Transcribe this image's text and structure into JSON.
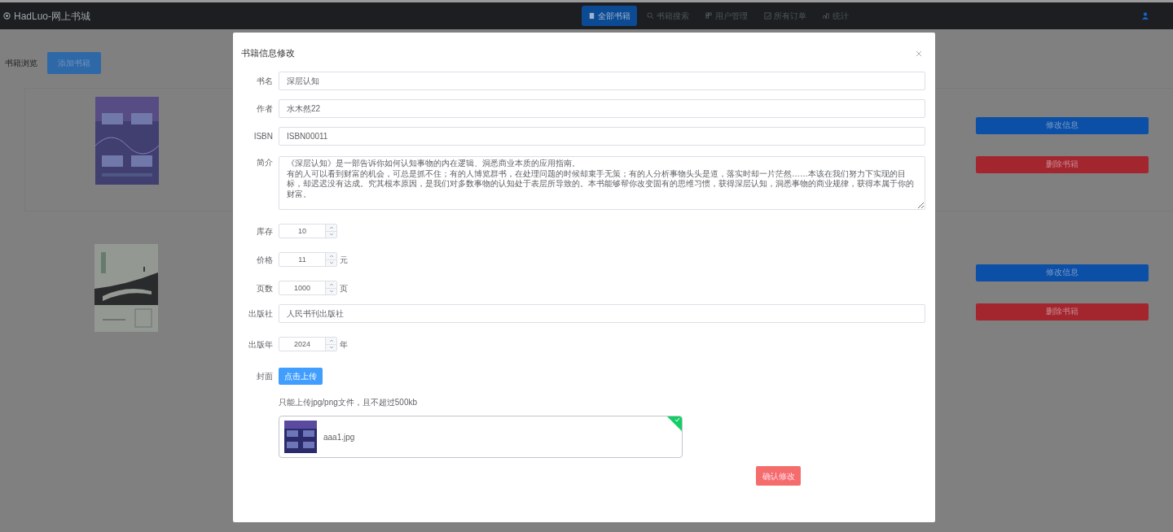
{
  "navbar": {
    "brand": "HadLuo-网上书城",
    "items": [
      {
        "label": "全部书籍",
        "selected": true
      },
      {
        "label": "书籍搜索",
        "selected": false
      },
      {
        "label": "用户管理",
        "selected": false
      },
      {
        "label": "所有订单",
        "selected": false
      },
      {
        "label": "统计",
        "selected": false
      }
    ]
  },
  "page": {
    "heading": "书籍浏览",
    "add_button": "添加书籍",
    "books": [
      {
        "buttons": [
          "修改信息",
          "删除书籍"
        ]
      },
      {
        "buttons": [
          "修改信息",
          "删除书籍"
        ]
      }
    ]
  },
  "modal": {
    "title": "书籍信息修改",
    "fields": [
      {
        "kind": "text",
        "label": "书名",
        "value": "深层认知"
      },
      {
        "kind": "text",
        "label": "作者",
        "value": "水木然22"
      },
      {
        "kind": "text",
        "label": "ISBN",
        "value": "ISBN00011"
      },
      {
        "kind": "textarea",
        "label": "简介",
        "lines": [
          "《深层认知》是一部告诉你如何认知事物的内在逻辑、洞悉商业本质的应用指南。",
          "有的人可以看到财富的机会，可总是抓不住；有的人博览群书，在处理问题的时候却束手无策；有的人分析事物头头是道，落实时却一片茫然……本该在我们努力下实现的目标，却迟迟没有达成。究其根本原因，是我们对多数事物的认知处于表层所导致的。本书能够帮你改变固有的思维习惯，获得深层认知，洞悉事物的商业规律，获得本属于你的财富。"
        ]
      },
      {
        "kind": "number",
        "label": "库存",
        "value": "10"
      },
      {
        "kind": "number",
        "label": "价格",
        "value": "11",
        "suffix": "元"
      },
      {
        "kind": "number",
        "label": "页数",
        "value": "1000",
        "suffix": "页"
      },
      {
        "kind": "text",
        "label": "出版社",
        "value": "人民书刊出版社"
      },
      {
        "kind": "number",
        "label": "出版年",
        "value": "2024",
        "suffix": "年"
      }
    ],
    "cover": {
      "label": "封面",
      "button": "点击上传",
      "hint": "只能上传jpg/png文件，且不超过500kb",
      "file": {
        "name": "aaa1.jpg",
        "uploaded": true
      }
    },
    "submit": "确认修改"
  }
}
